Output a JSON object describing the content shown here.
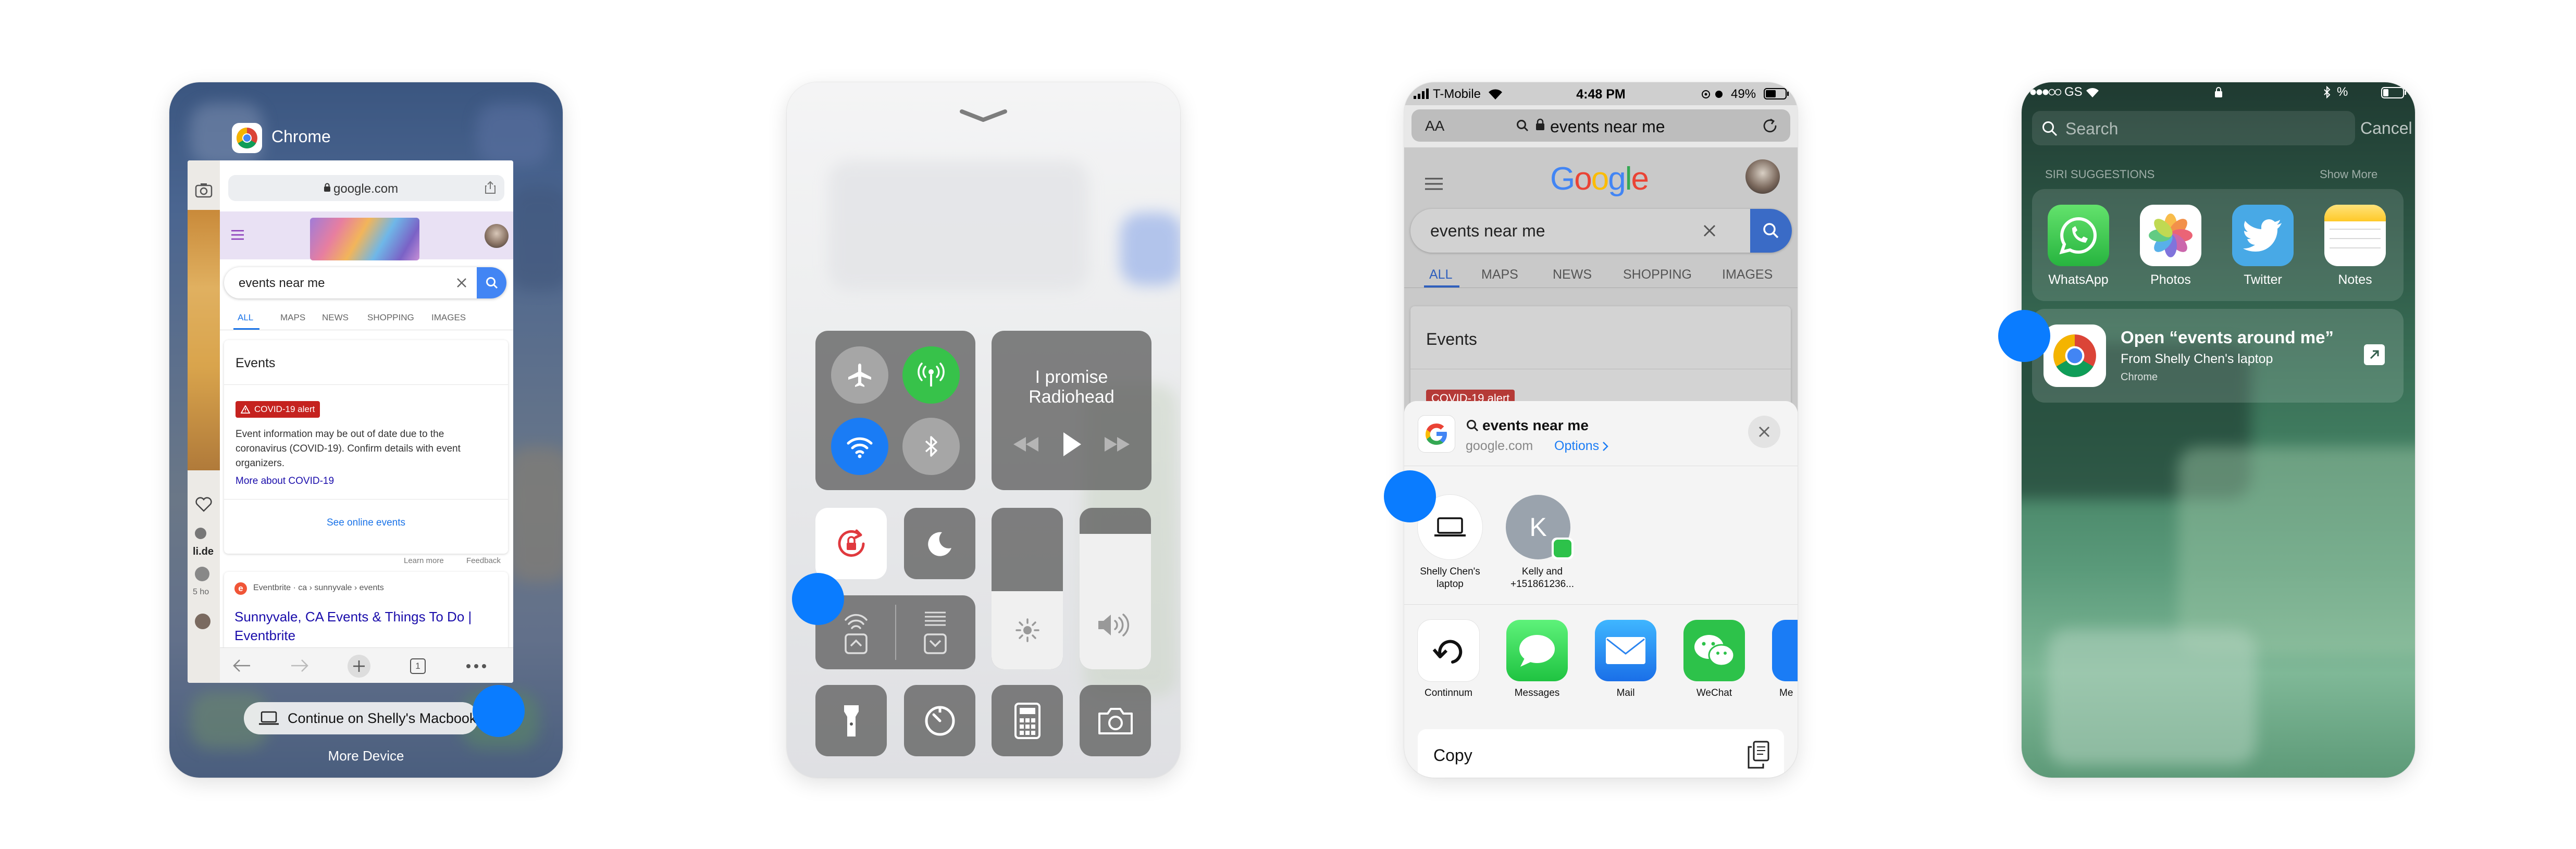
{
  "phone1": {
    "app_name": "Chrome",
    "url": "google.com",
    "search_query": "events near me",
    "tabs": [
      "ALL",
      "MAPS",
      "NEWS",
      "SHOPPING",
      "IMAGES"
    ],
    "events_heading": "Events",
    "covid_badge": "COVID-19 alert",
    "covid_text": "Event information may be out of date due to the coronavirus (COVID-19). Confirm details with event organizers.",
    "covid_link": "More about COVID-19",
    "online_events": "See online events",
    "learn_more": "Learn more",
    "feedback": "Feedback",
    "result_source": "Eventbrite · ca › sunnyvale › events",
    "result_title": "Sunnyvale, CA Events & Things To Do | Eventbrite",
    "tab_count": "1",
    "side_text_1": "li.de",
    "side_text_2": "5 ho",
    "continue_label": "Continue on Shelly's Macbook",
    "more_device": "More Device"
  },
  "phone2": {
    "now_playing_title": "I promise",
    "now_playing_artist": "Radiohead"
  },
  "phone3": {
    "carrier": "T-Mobile",
    "time": "4:48 PM",
    "battery": "49%",
    "aa": "AA",
    "url_text": "events near me",
    "google_logo": [
      "G",
      "o",
      "o",
      "g",
      "l",
      "e"
    ],
    "google_colors": [
      "#4285F4",
      "#EA4335",
      "#FBBC05",
      "#4285F4",
      "#34A853",
      "#EA4335"
    ],
    "search_query": "events near me",
    "tabs": [
      "ALL",
      "MAPS",
      "NEWS",
      "SHOPPING",
      "IMAGES"
    ],
    "events_heading": "Events",
    "covid_peek": "COVID-19 alert",
    "share_title": "events near me",
    "share_domain": "google.com",
    "share_options": "Options",
    "airdrop": [
      {
        "name": "Shelly Chen's\nlaptop"
      },
      {
        "name": "Kelly and\n+151861236...",
        "initial": "K"
      }
    ],
    "apps": [
      "Continnum",
      "Messages",
      "Mail",
      "WeChat",
      "Me"
    ],
    "copy_label": "Copy"
  },
  "phone4": {
    "carrier": "GS",
    "battery": "%",
    "search_placeholder": "Search",
    "cancel": "Cancel",
    "siri_label": "SIRI SUGGESTIONS",
    "show_more": "Show More",
    "apps": [
      "WhatsApp",
      "Photos",
      "Twitter",
      "Notes"
    ],
    "suggestion_title": "Open “events around me”",
    "suggestion_sub": "From Shelly Chen's laptop",
    "suggestion_app": "Chrome"
  }
}
